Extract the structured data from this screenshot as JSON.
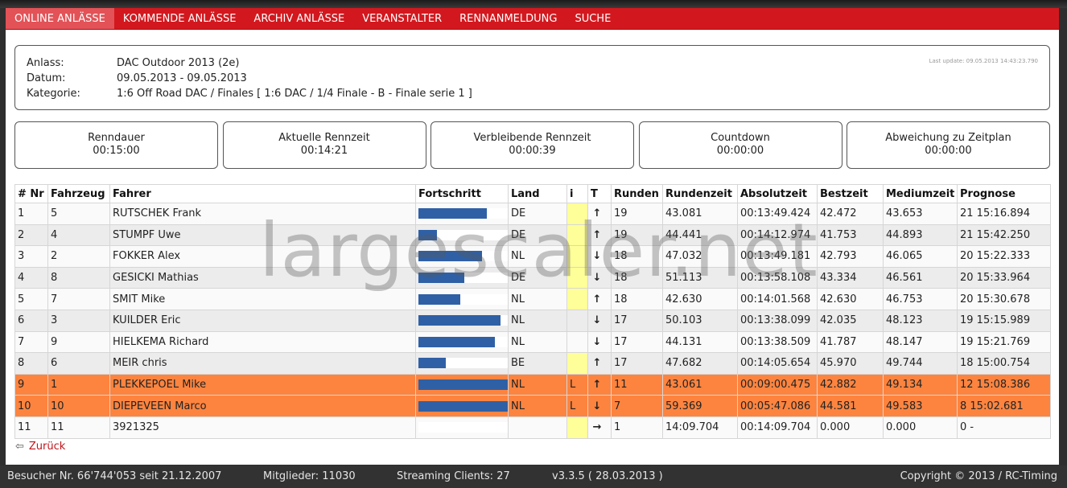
{
  "nav": [
    "ONLINE ANLÄSSE",
    "KOMMENDE ANLÄSSE",
    "ARCHIV ANLÄSSE",
    "VERANSTALTER",
    "RENNANMELDUNG",
    "SUCHE"
  ],
  "info": {
    "anlass_label": "Anlass:",
    "anlass": "DAC Outdoor 2013 (2e)",
    "datum_label": "Datum:",
    "datum": "09.05.2013 - 09.05.2013",
    "kategorie_label": "Kategorie:",
    "kategorie": "1:6 Off Road DAC / Finales [ 1:6 DAC / 1/4 Finale - B - Finale serie 1 ]",
    "last_update": "Last update: 09.05.2013 14:43:23.790"
  },
  "boxes": [
    {
      "label": "Renndauer",
      "value": "00:15:00"
    },
    {
      "label": "Aktuelle Rennzeit",
      "value": "00:14:21"
    },
    {
      "label": "Verbleibende Rennzeit",
      "value": "00:00:39"
    },
    {
      "label": "Countdown",
      "value": "00:00:00"
    },
    {
      "label": "Abweichung zu Zeitplan",
      "value": "00:00:00"
    }
  ],
  "columns": [
    "# Nr",
    "Fahrzeug",
    "Fahrer",
    "Fortschritt",
    "Land",
    "i",
    "T",
    "Runden",
    "Rundenzeit",
    "Absolutzeit",
    "Bestzeit",
    "Mediumzeit",
    "Prognose"
  ],
  "rows": [
    {
      "nr": "1",
      "fz": "5",
      "fahrer": "RUTSCHEK Frank",
      "progress": 0.75,
      "land": "DE",
      "i": "",
      "yellow": true,
      "trend": "up",
      "runden": "19",
      "rundenzeit": "43.081",
      "absolut": "00:13:49.424",
      "best": "42.472",
      "medium": "43.653",
      "prognose": "21 15:16.894",
      "hl": false
    },
    {
      "nr": "2",
      "fz": "4",
      "fahrer": "STUMPF Uwe",
      "progress": 0.2,
      "land": "DE",
      "i": "",
      "yellow": true,
      "trend": "up",
      "runden": "19",
      "rundenzeit": "44.441",
      "absolut": "00:14:12.974",
      "best": "41.753",
      "medium": "44.893",
      "prognose": "21 15:42.250",
      "hl": false
    },
    {
      "nr": "3",
      "fz": "2",
      "fahrer": "FOKKER Alex",
      "progress": 0.7,
      "land": "NL",
      "i": "",
      "yellow": true,
      "trend": "down",
      "runden": "18",
      "rundenzeit": "47.032",
      "absolut": "00:13:49.181",
      "best": "42.793",
      "medium": "46.065",
      "prognose": "20 15:22.333",
      "hl": false
    },
    {
      "nr": "4",
      "fz": "8",
      "fahrer": "GESICKI Mathias",
      "progress": 0.5,
      "land": "DE",
      "i": "",
      "yellow": true,
      "trend": "down",
      "runden": "18",
      "rundenzeit": "51.113",
      "absolut": "00:13:58.108",
      "best": "43.334",
      "medium": "46.561",
      "prognose": "20 15:33.964",
      "hl": false
    },
    {
      "nr": "5",
      "fz": "7",
      "fahrer": "SMIT Mike",
      "progress": 0.46,
      "land": "NL",
      "i": "",
      "yellow": true,
      "trend": "up",
      "runden": "18",
      "rundenzeit": "42.630",
      "absolut": "00:14:01.568",
      "best": "42.630",
      "medium": "46.753",
      "prognose": "20 15:30.678",
      "hl": false
    },
    {
      "nr": "6",
      "fz": "3",
      "fahrer": "KUILDER Eric",
      "progress": 0.9,
      "land": "NL",
      "i": "",
      "yellow": false,
      "trend": "down",
      "runden": "17",
      "rundenzeit": "50.103",
      "absolut": "00:13:38.099",
      "best": "42.035",
      "medium": "48.123",
      "prognose": "19 15:15.989",
      "hl": false
    },
    {
      "nr": "7",
      "fz": "9",
      "fahrer": "HIELKEMA Richard",
      "progress": 0.84,
      "land": "NL",
      "i": "",
      "yellow": false,
      "trend": "down",
      "runden": "17",
      "rundenzeit": "44.131",
      "absolut": "00:13:38.509",
      "best": "41.787",
      "medium": "48.147",
      "prognose": "19 15:21.769",
      "hl": false
    },
    {
      "nr": "8",
      "fz": "6",
      "fahrer": "MEIR chris",
      "progress": 0.3,
      "land": "BE",
      "i": "",
      "yellow": true,
      "trend": "up",
      "runden": "17",
      "rundenzeit": "47.682",
      "absolut": "00:14:05.654",
      "best": "45.970",
      "medium": "49.744",
      "prognose": "18 15:00.754",
      "hl": false
    },
    {
      "nr": "9",
      "fz": "1",
      "fahrer": "PLEKKEPOEL Mike",
      "progress": 1.0,
      "land": "NL",
      "i": "L",
      "yellow": false,
      "trend": "up",
      "runden": "11",
      "rundenzeit": "43.061",
      "absolut": "00:09:00.475",
      "best": "42.882",
      "medium": "49.134",
      "prognose": "12 15:08.386",
      "hl": true
    },
    {
      "nr": "10",
      "fz": "10",
      "fahrer": "DIEPEVEEN Marco",
      "progress": 1.0,
      "land": "NL",
      "i": "L",
      "yellow": false,
      "trend": "down",
      "runden": "7",
      "rundenzeit": "59.369",
      "absolut": "00:05:47.086",
      "best": "44.581",
      "medium": "49.583",
      "prognose": "8 15:02.681",
      "hl": true
    },
    {
      "nr": "11",
      "fz": "11",
      "fahrer": "3921325",
      "progress": 0.0,
      "land": "",
      "i": "",
      "yellow": true,
      "trend": "right",
      "runden": "1",
      "rundenzeit": "14:09.704",
      "absolut": "00:14:09.704",
      "best": "0.000",
      "medium": "0.000",
      "prognose": "0 -",
      "hl": false
    }
  ],
  "back_label": "Zurück",
  "watermark": "largescaler.net",
  "footer": {
    "besucher": "Besucher Nr. 66'744'053 seit 21.12.2007",
    "mitglieder": "Mitglieder: 11030",
    "streaming": "Streaming Clients: 27",
    "version": "v3.3.5 ( 28.03.2013 )",
    "copyright": "Copyright © 2013 / RC-Timing"
  },
  "colors": {
    "nav_red": "#d2181e",
    "highlight_orange": "#fd843f",
    "progress_blue": "#2f60a5",
    "info_yellow": "#ffff99"
  }
}
